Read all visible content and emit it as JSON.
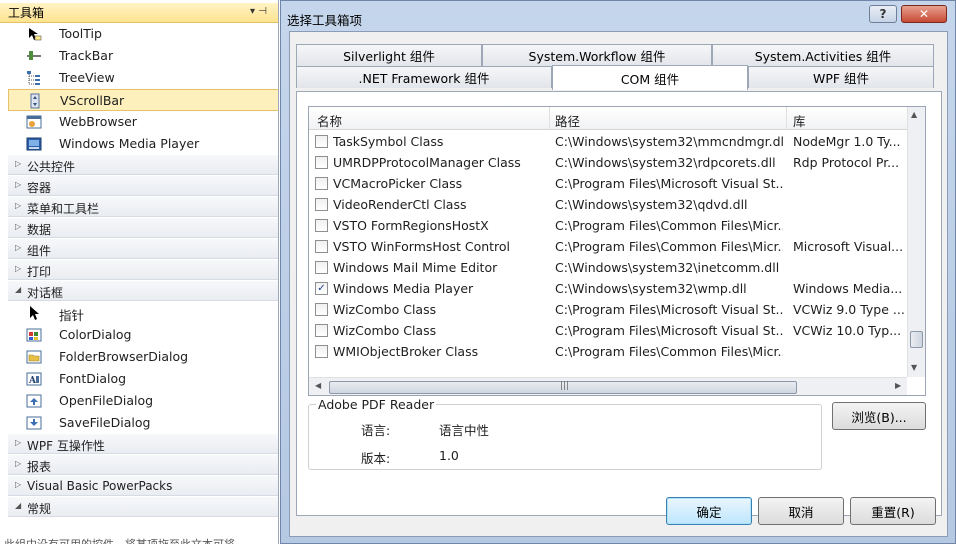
{
  "toolbox": {
    "title": "工具箱",
    "pin_glyph": "▾ ⊣",
    "close_glyph": "×",
    "items_top": [
      {
        "label": "ToolTip",
        "icon": "tooltip-icon"
      },
      {
        "label": "TrackBar",
        "icon": "trackbar-icon"
      },
      {
        "label": "TreeView",
        "icon": "treeview-icon"
      },
      {
        "label": "VScrollBar",
        "icon": "vscrollbar-icon",
        "selected": true
      },
      {
        "label": "WebBrowser",
        "icon": "webbrowser-icon"
      },
      {
        "label": "Windows Media Player",
        "icon": "media-player-icon"
      }
    ],
    "categories_a": [
      "公共控件",
      "容器",
      "菜单和工具栏",
      "数据",
      "组件",
      "打印"
    ],
    "dialogs_category": "对话框",
    "dialog_items": [
      {
        "label": "指针",
        "icon": "pointer-icon"
      },
      {
        "label": "ColorDialog",
        "icon": "color-dialog-icon"
      },
      {
        "label": "FolderBrowserDialog",
        "icon": "folder-browser-icon"
      },
      {
        "label": "FontDialog",
        "icon": "font-dialog-icon"
      },
      {
        "label": "OpenFileDialog",
        "icon": "open-file-icon"
      },
      {
        "label": "SaveFileDialog",
        "icon": "save-file-icon"
      }
    ],
    "categories_b": [
      "WPF 互操作性",
      "报表",
      "Visual Basic PowerPacks",
      "常规"
    ],
    "footer_text": "此组中没有可用的控件。将某项拖至此文本可将..."
  },
  "dialog": {
    "title": "选择工具箱项",
    "help_label": "?",
    "close_label": "✕",
    "tabs_row1": [
      "Silverlight 组件",
      "System.Workflow 组件",
      "System.Activities 组件"
    ],
    "tabs_row2": [
      ".NET Framework 组件",
      "COM 组件",
      "WPF 组件"
    ],
    "active_tab": "COM 组件",
    "columns": [
      "名称",
      "路径",
      "库"
    ],
    "rows": [
      {
        "name": "TaskSymbol Class",
        "path": "C:\\Windows\\system32\\mmcndmgr.dll",
        "lib": "NodeMgr 1.0 Ty...",
        "checked": false
      },
      {
        "name": "UMRDPProtocolManager  Class",
        "path": "C:\\Windows\\system32\\rdpcorets.dll",
        "lib": "Rdp Protocol Pr...",
        "checked": false
      },
      {
        "name": "VCMacroPicker Class",
        "path": "C:\\Program Files\\Microsoft Visual St...",
        "lib": "",
        "checked": false
      },
      {
        "name": "VideoRenderCtl Class",
        "path": "C:\\Windows\\system32\\qdvd.dll",
        "lib": "",
        "checked": false
      },
      {
        "name": "VSTO FormRegionsHostX",
        "path": "C:\\Program Files\\Common Files\\Micr...",
        "lib": "",
        "checked": false
      },
      {
        "name": "VSTO WinFormsHost Control",
        "path": "C:\\Program Files\\Common Files\\Micr...",
        "lib": "Microsoft Visual...",
        "checked": false
      },
      {
        "name": "Windows Mail Mime Editor",
        "path": "C:\\Windows\\system32\\inetcomm.dll",
        "lib": "",
        "checked": false
      },
      {
        "name": "Windows Media Player",
        "path": "C:\\Windows\\system32\\wmp.dll",
        "lib": "Windows Media...",
        "checked": true
      },
      {
        "name": "WizCombo Class",
        "path": "C:\\Program Files\\Microsoft Visual St...",
        "lib": "VCWiz 9.0 Type ...",
        "checked": false
      },
      {
        "name": "WizCombo Class",
        "path": "C:\\Program Files\\Microsoft Visual St...",
        "lib": "VCWiz 10.0 Typ...",
        "checked": false
      },
      {
        "name": "WMIObjectBroker Class",
        "path": "C:\\Program Files\\Common Files\\Micr...",
        "lib": "",
        "checked": false
      }
    ],
    "details": {
      "group_title": "Adobe PDF Reader",
      "language_label": "语言:",
      "language_value": "语言中性",
      "version_label": "版本:",
      "version_value": "1.0"
    },
    "browse_label": "浏览(B)...",
    "ok_label": "确定",
    "cancel_label": "取消",
    "reset_label": "重置(R)",
    "check_glyph": "✓"
  },
  "colors": {
    "selection": "#fdf0bd",
    "dialog_frame": "#b6c9e3",
    "close_red": "#c74a34"
  }
}
